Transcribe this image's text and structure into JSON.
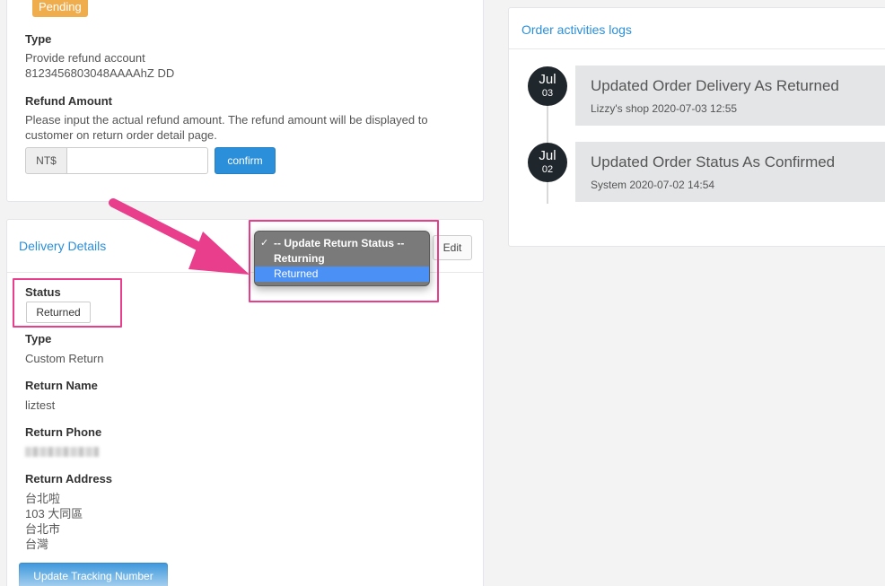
{
  "refund": {
    "status_badge": "Pending",
    "type_label": "Type",
    "type_line1": "Provide refund account",
    "type_line2": "8123456803048AAAAhZ DD",
    "amount_label": "Refund Amount",
    "amount_desc1": "Please input the actual refund amount. The refund amount will be displayed to",
    "amount_desc2": "customer on return order detail page.",
    "currency": "NT$",
    "amount_value": "",
    "confirm_label": "confirm"
  },
  "delivery": {
    "title": "Delivery Details",
    "edit_label": "Edit",
    "status_label": "Status",
    "status_value": "Returned",
    "type_label": "Type",
    "type_value": "Custom Return",
    "name_label": "Return Name",
    "name_value": "liztest",
    "phone_label": "Return Phone",
    "address_label": "Return Address",
    "address_lines": [
      "台北啦",
      "103 大同區",
      "台北市",
      "台灣"
    ],
    "update_tracking_label": "Update Tracking Number"
  },
  "dropdown": {
    "options": [
      "-- Update Return Status --",
      "Returning",
      "Returned"
    ],
    "checked_index": 0,
    "highlighted_index": 2
  },
  "logs": {
    "title": "Order activities logs",
    "items": [
      {
        "month": "Jul",
        "day": "03",
        "title": "Updated Order Delivery As Returned",
        "meta": "Lizzy's shop 2020-07-03 12:55"
      },
      {
        "month": "Jul",
        "day": "02",
        "title": "Updated Order Status As Confirmed",
        "meta": "System 2020-07-02 14:54"
      }
    ]
  },
  "colors": {
    "accent": "#2b8fd9",
    "badge": "#f0ad4e",
    "highlight": "#e83e8c",
    "dropdown_selected": "#4a90f5"
  }
}
